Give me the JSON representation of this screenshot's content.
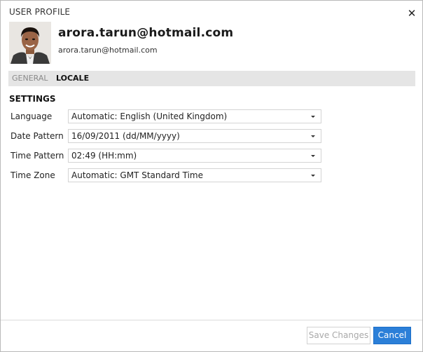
{
  "dialog": {
    "title": "USER PROFILE",
    "close_icon": "close-icon"
  },
  "user": {
    "name": "arora.tarun@hotmail.com",
    "email": "arora.tarun@hotmail.com"
  },
  "tabs": [
    {
      "label": "GENERAL",
      "active": false
    },
    {
      "label": "LOCALE",
      "active": true
    }
  ],
  "settings": {
    "title": "SETTINGS",
    "rows": [
      {
        "label": "Language",
        "value": "Automatic: English (United Kingdom)"
      },
      {
        "label": "Date Pattern",
        "value": "16/09/2011 (dd/MM/yyyy)"
      },
      {
        "label": "Time Pattern",
        "value": "02:49 (HH:mm)"
      },
      {
        "label": "Time Zone",
        "value": "Automatic: GMT Standard Time"
      }
    ]
  },
  "footer": {
    "save_label": "Save Changes",
    "cancel_label": "Cancel"
  },
  "colors": {
    "primary": "#2b7fd8",
    "tabbar": "#e5e5e5",
    "disabled_text": "#a9a9a9"
  }
}
